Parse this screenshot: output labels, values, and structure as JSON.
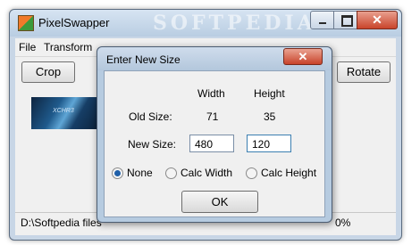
{
  "window": {
    "title": "PixelSwapper",
    "watermark": "SOFTPEDIA"
  },
  "menu": {
    "items": [
      "File",
      "Transform"
    ]
  },
  "toolbar": {
    "crop_label": "Crop",
    "rotate_label": "Rotate"
  },
  "thumbnail": {
    "caption": "XCHR3"
  },
  "status": {
    "path": "D:\\Softpedia files",
    "percent": "0%"
  },
  "dialog": {
    "title": "Enter New Size",
    "close_glyph": "✕",
    "col_width": "Width",
    "col_height": "Height",
    "old_size_label": "Old Size:",
    "old_width": "71",
    "old_height": "35",
    "new_size_label": "New Size:",
    "new_width": "480",
    "new_height": "120",
    "radios": [
      {
        "label": "None",
        "checked": true
      },
      {
        "label": "Calc Width",
        "checked": false
      },
      {
        "label": "Calc Height",
        "checked": false
      }
    ],
    "ok_label": "OK"
  },
  "controls": {
    "minimize": "minimize",
    "maximize": "maximize",
    "close": "✕"
  }
}
